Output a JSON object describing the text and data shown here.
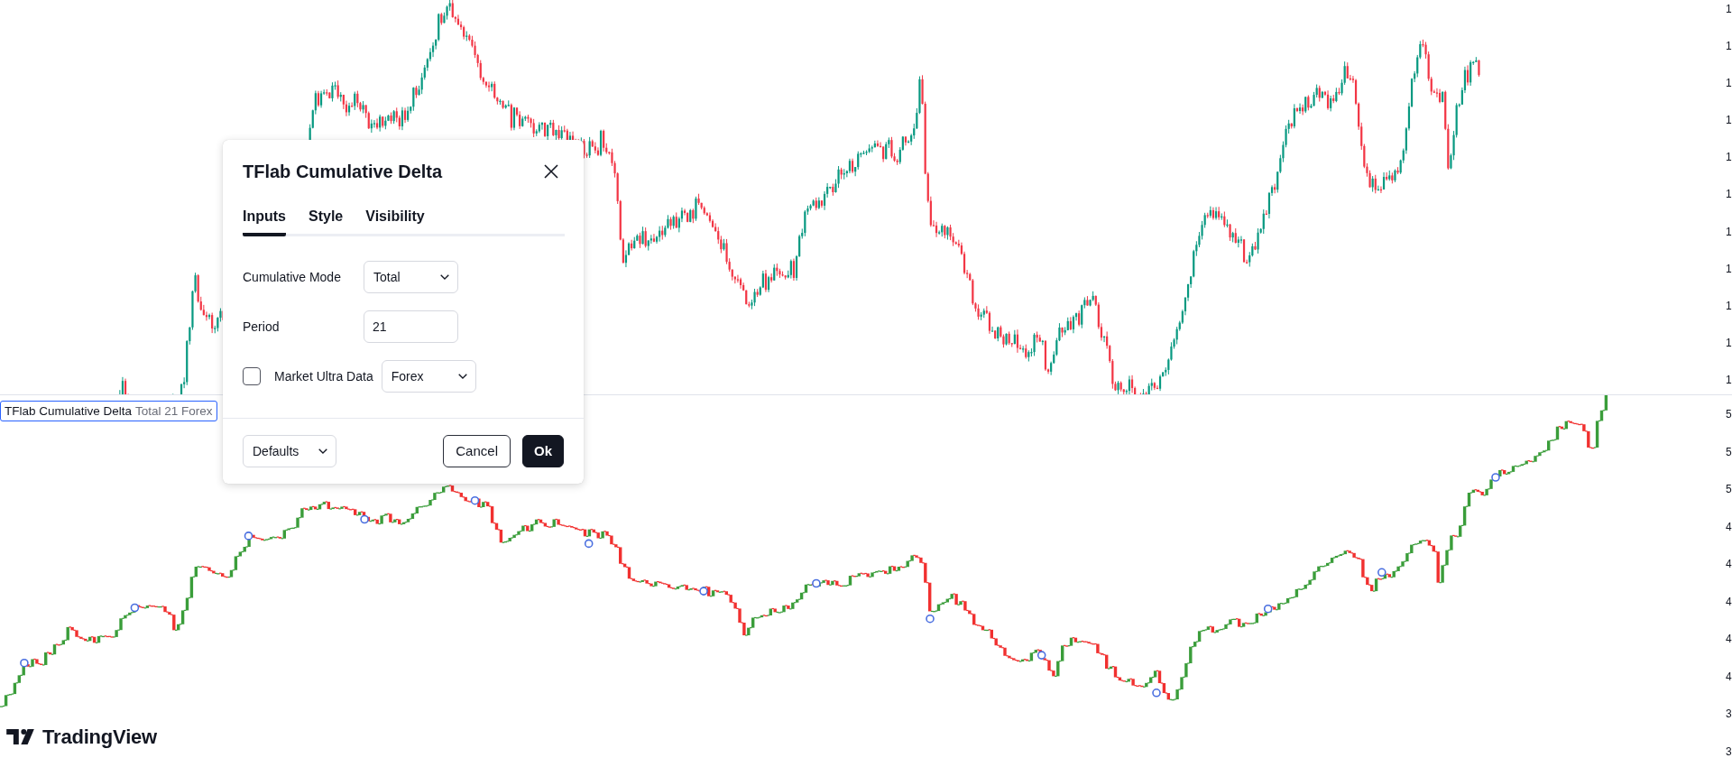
{
  "chart": {
    "main_pane": {
      "price_axis": [
        "1",
        "1",
        "1",
        "1",
        "1",
        "1",
        "1",
        "1",
        "1",
        "1",
        "1"
      ]
    },
    "indicator_pane": {
      "legend": {
        "title": "TFlab Cumulative Delta",
        "values": "Total 21 Forex"
      },
      "price_axis": [
        "5",
        "5",
        "5",
        "4",
        "4",
        "4",
        "4",
        "4",
        "3",
        "3"
      ]
    },
    "logo": {
      "text": "TradingView"
    }
  },
  "dialog": {
    "title": "TFlab Cumulative Delta",
    "tabs": [
      {
        "label": "Inputs",
        "selected": true
      },
      {
        "label": "Style",
        "selected": false
      },
      {
        "label": "Visibility",
        "selected": false
      }
    ],
    "fields": [
      {
        "kind": "select",
        "label": "Cumulative Mode",
        "value": "Total"
      },
      {
        "kind": "input",
        "label": "Period",
        "value": "21"
      },
      {
        "kind": "checkbox_select",
        "label": "Market Ultra Data",
        "checked": false,
        "value": "Forex"
      }
    ],
    "defaults": "Defaults",
    "buttons": [
      {
        "kind": "secondary",
        "label": "Cancel"
      },
      {
        "kind": "primary",
        "label": "Ok"
      }
    ]
  }
}
